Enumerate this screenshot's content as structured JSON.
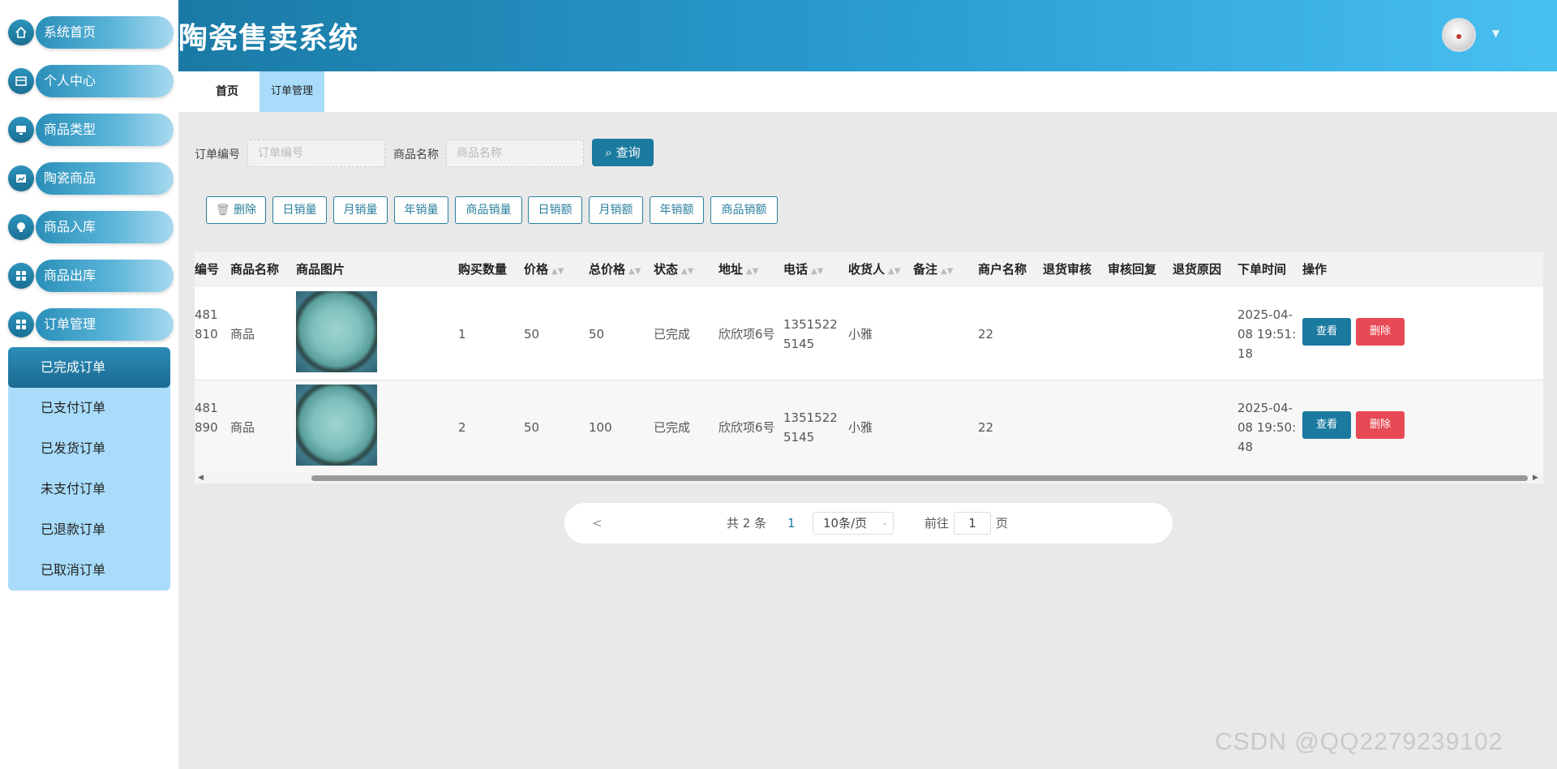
{
  "app": {
    "title": "陶瓷售卖系统"
  },
  "sidebar": {
    "items": [
      {
        "label": "系统首页",
        "icon": "home-icon"
      },
      {
        "label": "个人中心",
        "icon": "card-icon"
      },
      {
        "label": "商品类型",
        "icon": "monitor-icon"
      },
      {
        "label": "陶瓷商品",
        "icon": "chart-icon"
      },
      {
        "label": "商品入库",
        "icon": "bulb-icon"
      },
      {
        "label": "商品出库",
        "icon": "grid-icon"
      },
      {
        "label": "订单管理",
        "icon": "grid-icon"
      }
    ],
    "submenu": [
      {
        "label": "已完成订单",
        "active": true
      },
      {
        "label": "已支付订单"
      },
      {
        "label": "已发货订单"
      },
      {
        "label": "未支付订单"
      },
      {
        "label": "已退款订单"
      },
      {
        "label": "已取消订单"
      }
    ]
  },
  "tabs": [
    {
      "label": "首页"
    },
    {
      "label": "订单管理",
      "active": true
    }
  ],
  "search": {
    "order_no_label": "订单编号",
    "order_no_placeholder": "订单编号",
    "product_name_label": "商品名称",
    "product_name_placeholder": "商品名称",
    "query_label": "查询"
  },
  "actions": {
    "delete": "删除",
    "daily_sales_qty": "日销量",
    "monthly_sales_qty": "月销量",
    "yearly_sales_qty": "年销量",
    "product_sales_qty": "商品销量",
    "daily_sales_amount": "日销额",
    "monthly_sales_amount": "月销额",
    "yearly_sales_amount": "年销额",
    "product_sales_amount": "商品销额"
  },
  "table": {
    "columns": [
      "编号",
      "商品名称",
      "商品图片",
      "购买数量",
      "价格",
      "总价格",
      "状态",
      "地址",
      "电话",
      "收货人",
      "备注",
      "商户名称",
      "退货审核",
      "审核回复",
      "退货原因",
      "下单时间",
      "操作"
    ],
    "rows": [
      {
        "order_no_line1": "481",
        "order_no_line2": "810",
        "product_name": "商品",
        "quantity": "1",
        "price": "50",
        "total": "50",
        "status": "已完成",
        "address": "欣欣项6号",
        "phone_line1": "1351522",
        "phone_line2": "5145",
        "receiver": "小雅",
        "note": "",
        "merchant": "22",
        "return_review": "",
        "review_reply": "",
        "return_reason": "",
        "time_line1": "2025-04-",
        "time_line2": "08 19:51:",
        "time_line3": "18",
        "view": "查看",
        "delete": "删除"
      },
      {
        "order_no_line1": "481",
        "order_no_line2": "890",
        "product_name": "商品",
        "quantity": "2",
        "price": "50",
        "total": "100",
        "status": "已完成",
        "address": "欣欣项6号",
        "phone_line1": "1351522",
        "phone_line2": "5145",
        "receiver": "小雅",
        "note": "",
        "merchant": "22",
        "return_review": "",
        "review_reply": "",
        "return_reason": "",
        "time_line1": "2025-04-",
        "time_line2": "08 19:50:",
        "time_line3": "48",
        "view": "查看",
        "delete": "删除"
      }
    ]
  },
  "pagination": {
    "prev": "<",
    "total": "共 2 条",
    "current_page": "1",
    "page_size": "10条/页",
    "goto_label": "前往",
    "goto_value": "1",
    "page_unit": "页"
  },
  "watermark": "CSDN @QQ2279239102"
}
